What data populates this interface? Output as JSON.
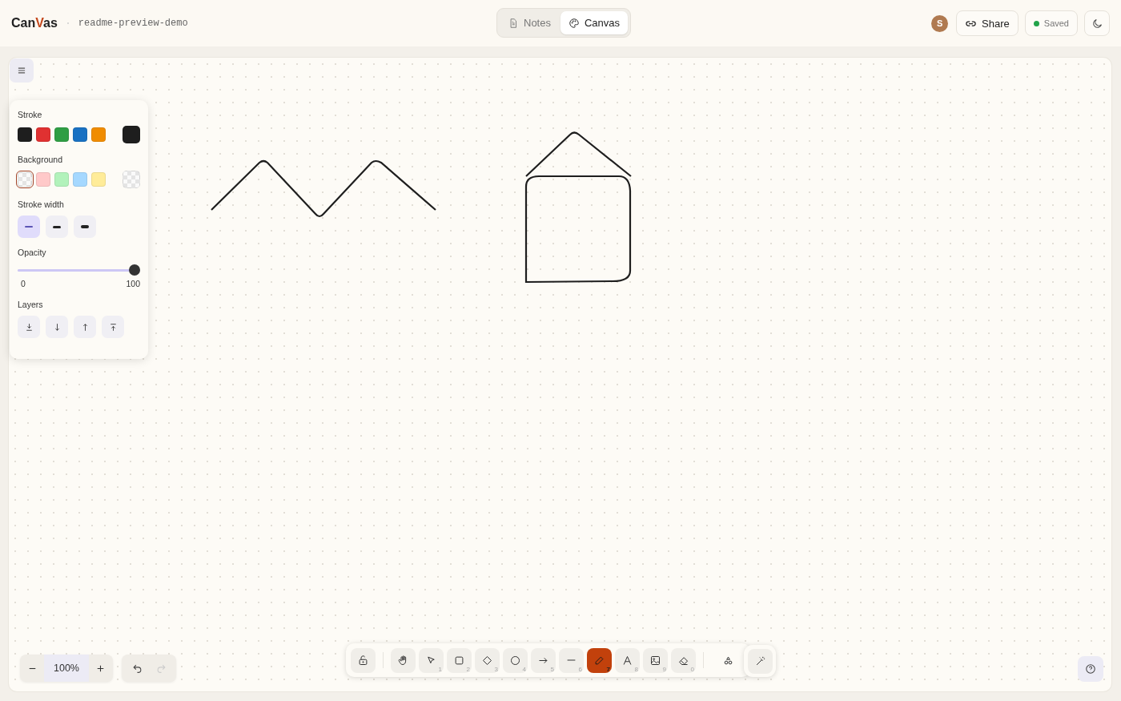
{
  "header": {
    "logo": [
      {
        "text": "Can",
        "accent": false
      },
      {
        "text": "V",
        "accent": true
      },
      {
        "text": "as",
        "accent": false
      }
    ],
    "file_name": "readme-preview-demo",
    "tabs": [
      {
        "label": "Notes",
        "selected": false
      },
      {
        "label": "Canvas",
        "selected": true
      }
    ],
    "avatar": "S",
    "share": "Share",
    "status": {
      "label": "Saved",
      "color": "#22a34a"
    }
  },
  "panel": {
    "stroke": {
      "label": "Stroke",
      "swatches": [
        {
          "color": "#1e1e1e"
        },
        {
          "color": "#e03131"
        },
        {
          "color": "#2f9e44"
        },
        {
          "color": "#1971c2"
        },
        {
          "color": "#f08c00"
        }
      ],
      "current": {
        "color": "#1e1e1e"
      }
    },
    "background": {
      "label": "Background",
      "swatches": [
        {
          "kind": "transparent",
          "selected": true
        },
        {
          "kind": "solid",
          "color": "#ffc9c9",
          "selected": false
        },
        {
          "kind": "solid",
          "color": "#b2f2bb",
          "selected": false
        },
        {
          "kind": "solid",
          "color": "#a5d8ff",
          "selected": false
        },
        {
          "kind": "solid",
          "color": "#ffec99",
          "selected": false
        }
      ]
    },
    "stroke_width": {
      "label": "Stroke width",
      "options": [
        {
          "selected": true
        },
        {
          "selected": false
        },
        {
          "selected": false
        }
      ]
    },
    "opacity": {
      "label": "Opacity",
      "level": 1,
      "min": "0",
      "max": "100"
    },
    "layers": {
      "label": "Layers"
    }
  },
  "toolbar": {
    "tools": [
      {
        "kind": "lock",
        "selected": false
      },
      {
        "kind": "hand",
        "selected": false
      },
      {
        "kind": "select",
        "shortcut": "1",
        "selected": false
      },
      {
        "kind": "rectangle",
        "shortcut": "2",
        "selected": false
      },
      {
        "kind": "diamond",
        "shortcut": "3",
        "selected": false
      },
      {
        "kind": "ellipse",
        "shortcut": "4",
        "selected": false
      },
      {
        "kind": "arrow",
        "shortcut": "5",
        "selected": false
      },
      {
        "kind": "line",
        "shortcut": "6",
        "selected": false
      },
      {
        "kind": "pencil",
        "shortcut": "7",
        "selected": true
      },
      {
        "kind": "text",
        "shortcut": "8",
        "selected": false
      },
      {
        "kind": "image",
        "shortcut": "9",
        "selected": false
      },
      {
        "kind": "eraser",
        "shortcut": "0",
        "selected": false
      },
      {
        "kind": "shapes",
        "selected": false
      }
    ]
  },
  "zoom": {
    "value": "100%"
  }
}
